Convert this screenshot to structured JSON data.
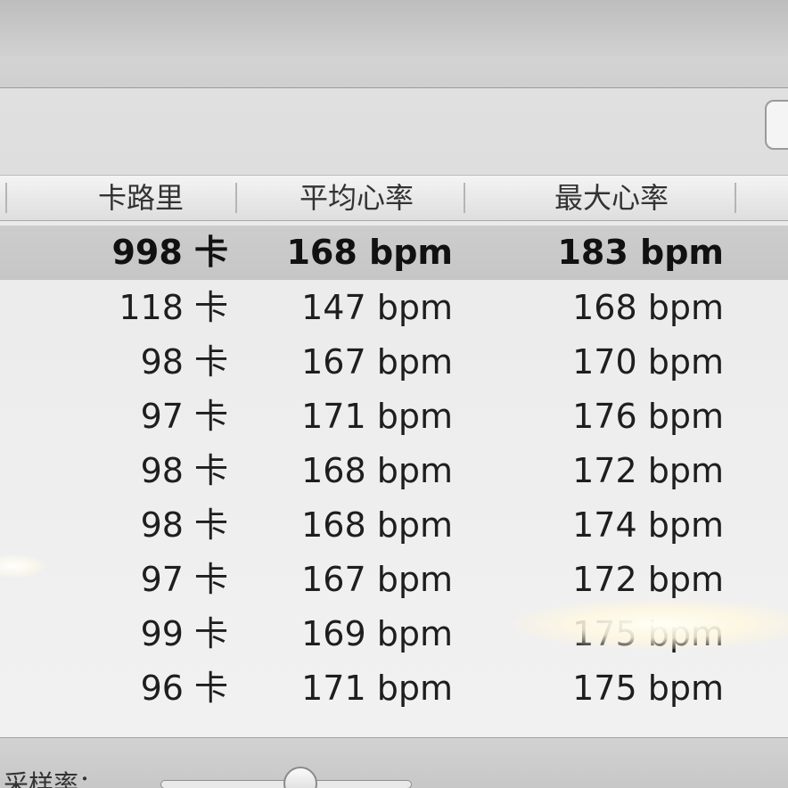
{
  "table": {
    "columns": [
      {
        "label": "卡路里"
      },
      {
        "label": "平均心率"
      },
      {
        "label": "最大心率"
      }
    ],
    "rows": [
      {
        "calories": "998 卡",
        "avg_hr": "168 bpm",
        "max_hr": "183 bpm",
        "selected": true
      },
      {
        "calories": "118 卡",
        "avg_hr": "147 bpm",
        "max_hr": "168 bpm"
      },
      {
        "calories": "98 卡",
        "avg_hr": "167 bpm",
        "max_hr": "170 bpm"
      },
      {
        "calories": "97 卡",
        "avg_hr": "171 bpm",
        "max_hr": "176 bpm"
      },
      {
        "calories": "98 卡",
        "avg_hr": "168 bpm",
        "max_hr": "172 bpm"
      },
      {
        "calories": "98 卡",
        "avg_hr": "168 bpm",
        "max_hr": "174 bpm"
      },
      {
        "calories": "97 卡",
        "avg_hr": "167 bpm",
        "max_hr": "172 bpm"
      },
      {
        "calories": "99 卡",
        "avg_hr": "169 bpm",
        "max_hr": "175 bpm"
      },
      {
        "calories": "96 卡",
        "avg_hr": "171 bpm",
        "max_hr": "175 bpm"
      }
    ]
  },
  "footer": {
    "label": "采样率："
  }
}
